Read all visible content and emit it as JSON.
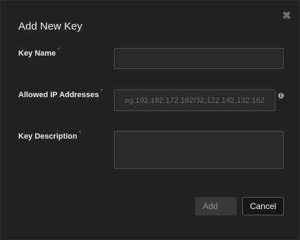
{
  "dialog": {
    "title": "Add New Key",
    "close_icon": "close-icon",
    "fields": {
      "key_name": {
        "label": "Key Name",
        "required_mark": "*",
        "value": "",
        "placeholder": ""
      },
      "allowed_ip": {
        "label": "Allowed IP Addresses",
        "required_mark": "*",
        "value": "",
        "placeholder": "eg.192.182.172.162/32,122.142.132.162/32",
        "info_icon": "info-icon"
      },
      "key_description": {
        "label": "Key Description",
        "required_mark": "*",
        "value": "",
        "placeholder": ""
      }
    },
    "buttons": {
      "add_label": "Add",
      "cancel_label": "Cancel"
    }
  },
  "colors": {
    "background": "#222222",
    "required_mark": "#d6334a",
    "field_border": "#4a4a4a"
  }
}
